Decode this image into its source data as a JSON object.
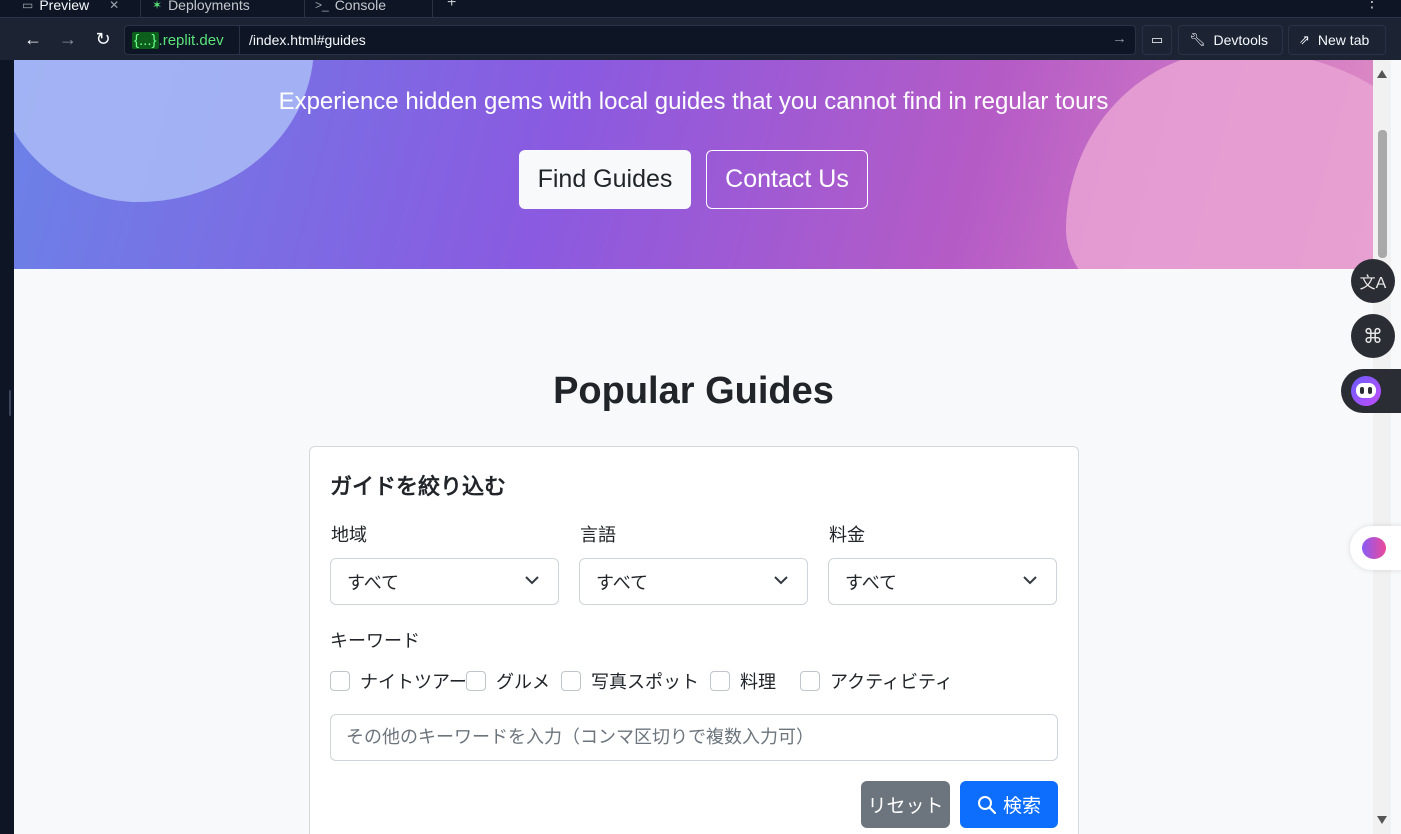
{
  "browser": {
    "tabs": [
      {
        "label": "Preview",
        "icon": "monitor-icon"
      },
      {
        "label": "Deployments",
        "icon": "deploy-icon"
      },
      {
        "label": "Console",
        "icon": "terminal-icon"
      }
    ],
    "url_domain_badge": "{...}",
    "url_domain": ".replit.dev",
    "url_path": "/index.html#guides",
    "devtools_label": "Devtools",
    "newtab_label": "New tab"
  },
  "hero": {
    "subtitle": "Experience hidden gems with local guides that you cannot find in regular tours",
    "find_button": "Find Guides",
    "contact_button": "Contact Us"
  },
  "guides": {
    "title": "Popular Guides"
  },
  "filter": {
    "title": "ガイドを絞り込む",
    "fields": [
      {
        "label": "地域",
        "value": "すべて"
      },
      {
        "label": "言語",
        "value": "すべて"
      },
      {
        "label": "料金",
        "value": "すべて"
      }
    ],
    "keyword_label": "キーワード",
    "checkboxes": [
      "ナイトツアー",
      "グルメ",
      "写真スポット",
      "料理",
      "アクティビティ"
    ],
    "keyword_placeholder": "その他のキーワードを入力（コンマ区切りで複数入力可）",
    "reset_button": "リセット",
    "search_button": "検索"
  },
  "colors": {
    "primary": "#0d6efd",
    "secondary": "#6c757d",
    "editor_bg": "#0e1525"
  }
}
